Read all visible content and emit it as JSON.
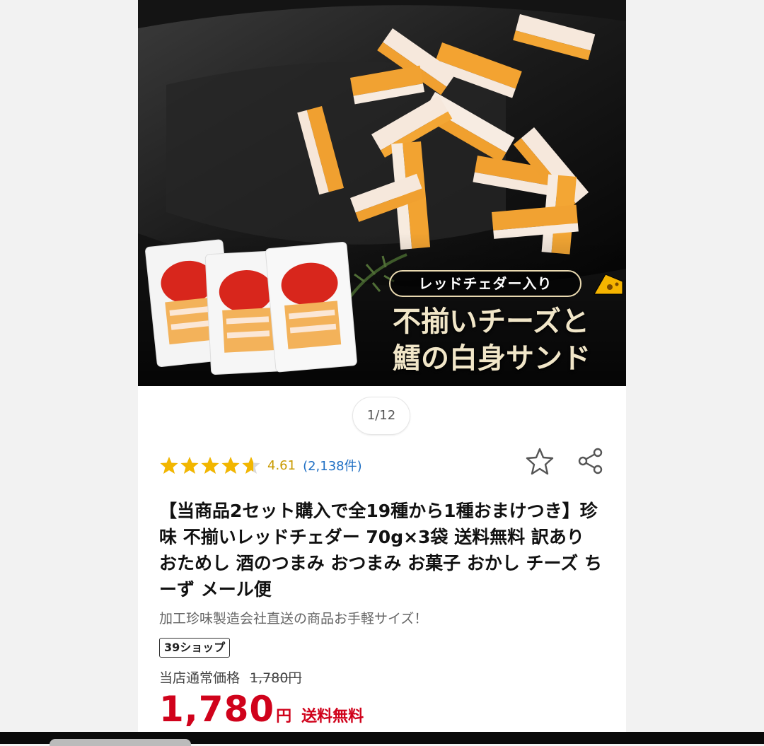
{
  "hero": {
    "badge_label": "レッドチェダー入り",
    "title_line1": "不揃いチーズと",
    "title_line2": "鱈の白身サンド",
    "package_label": "不揃いチーズ"
  },
  "pager": {
    "text": "1/12",
    "current": 1,
    "total": 12
  },
  "rating": {
    "stars_filled": 4.61,
    "stars_max": 5,
    "value": "4.61",
    "count_text": "(2,138件)",
    "star_color": "#f2b600"
  },
  "icons": {
    "favorite": "star-outline-icon",
    "share": "share-icon"
  },
  "product": {
    "title": "【当商品2セット購入で全19種から1種おまけつき】珍味 不揃いレッドチェダー 70g×3袋 送料無料 訳あり おためし 酒のつまみ おつまみ お菓子 おかし チーズ ちーず メール便",
    "catch_copy": "加工珍味製造会社直送の商品お手軽サイズ！",
    "shop_badge": "39ショップ"
  },
  "price": {
    "regular_label": "当店通常価格",
    "regular_value": "1,780円",
    "sale_value": "1,780",
    "sale_unit": "円",
    "shipping": "送料無料",
    "sale_color": "#d0021b"
  }
}
